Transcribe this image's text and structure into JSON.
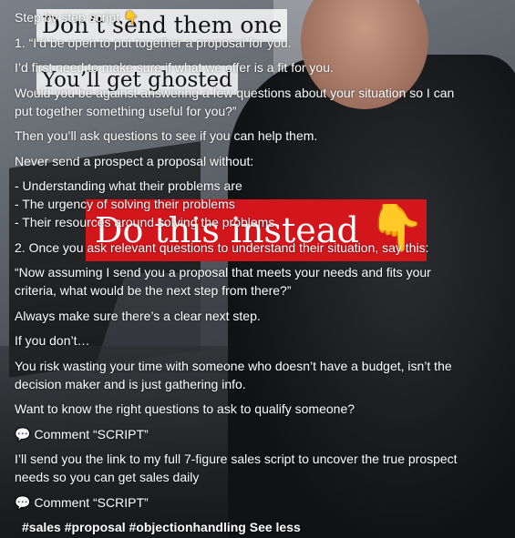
{
  "overlays": {
    "tag1": "Don’t send them one",
    "tag2": "You’ll get ghosted",
    "tag3": "Do this instead",
    "tag3_icon": "pointing-down-hand-icon"
  },
  "caption": {
    "l1": "Step by step script",
    "l1_icon": "pointing-down-hand-icon",
    "l2": "1. “I’d be open to put together a proposal for you.",
    "l3": "I’d first need to make sure if what we offer is a fit for you.",
    "l4": "Would you be against answering a few questions about your situation so I can",
    "l5": "put together something useful for you?”",
    "l6": "Then you’ll ask questions to see if you can help them.",
    "l7": "Never send a prospect a proposal without:",
    "l8": "- Understanding what their problems are",
    "l9": "- The urgency of solving their problems",
    "l10": "- Their resources around solving the problems",
    "l11": "2. Once you ask relevant questions to understand their situation, say this:",
    "l12": "“Now assuming I send you a proposal that meets your needs and fits your",
    "l13": "criteria, what would be the next step from there?”",
    "l14": "Always make sure there’s a clear next step.",
    "l15": "If you don’t…",
    "l16": "You risk wasting your time with someone who doesn’t have a budget, isn’t the",
    "l17": "decision maker and is just gathering info.",
    "l18": "Want to know the right questions to ask to qualify someone?",
    "l19": "Comment “SCRIPT”",
    "l19_icon": "speech-bubble-icon",
    "l20": "I’ll send you the link to my full 7-figure sales script to uncover the true prospect",
    "l21": "needs so you can get sales daily",
    "l22": "Comment “SCRIPT”",
    "l22_icon": "speech-bubble-icon",
    "hashtags": "#sales #proposal #objectionhandling",
    "see_less": "See less"
  }
}
